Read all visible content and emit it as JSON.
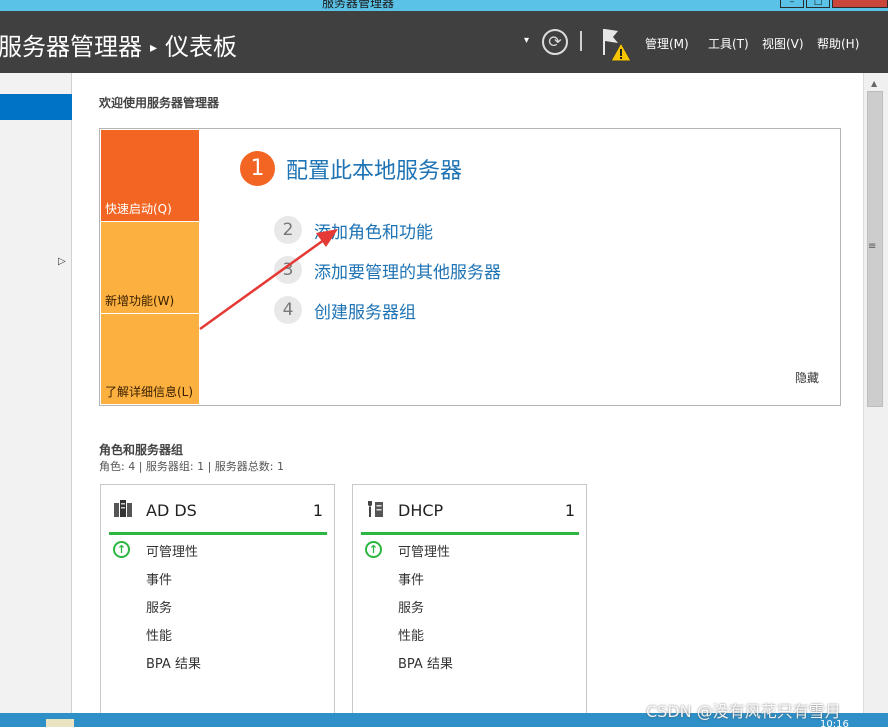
{
  "window": {
    "title": "服务器管理器"
  },
  "header": {
    "breadcrumb_root": "服务器管理器",
    "breadcrumb_sep": "▸",
    "breadcrumb_current": "仪表板",
    "dropdown_glyph": "▾",
    "refresh_glyph": "⟳",
    "separator_glyph": "|",
    "notification_icon": "flag-warning-icon",
    "menus": [
      "管理(M)",
      "工具(T)",
      "视图(V)",
      "帮助(H)"
    ]
  },
  "welcome": {
    "title": "欢迎使用服务器管理器",
    "tiles": [
      "快速启动(Q)",
      "新增功能(W)",
      "了解详细信息(L)"
    ],
    "steps": [
      {
        "num": "1",
        "label": "配置此本地服务器"
      },
      {
        "num": "2",
        "label": "添加角色和功能"
      },
      {
        "num": "3",
        "label": "添加要管理的其他服务器"
      },
      {
        "num": "4",
        "label": "创建服务器组"
      }
    ],
    "hide_label": "隐藏"
  },
  "roles": {
    "title": "角色和服务器组",
    "summary": "角色: 4 | 服务器组: 1 | 服务器总数: 1",
    "cards": [
      {
        "name": "AD DS",
        "count": "1",
        "icon": "ad-ds-icon",
        "rows": [
          "可管理性",
          "事件",
          "服务",
          "性能",
          "BPA 结果"
        ]
      },
      {
        "name": "DHCP",
        "count": "1",
        "icon": "dhcp-icon",
        "rows": [
          "可管理性",
          "事件",
          "服务",
          "性能",
          "BPA 结果"
        ]
      }
    ]
  },
  "taskbar": {
    "clock": "10:16"
  },
  "watermark": "CSDN @没有风花只有雪月",
  "colors": {
    "header_bg": "#404040",
    "accent_blue": "#1e73b4",
    "orange": "#f26522",
    "amber": "#fbb040",
    "status_green": "#2cb742",
    "selection_blue": "#0073c6"
  }
}
